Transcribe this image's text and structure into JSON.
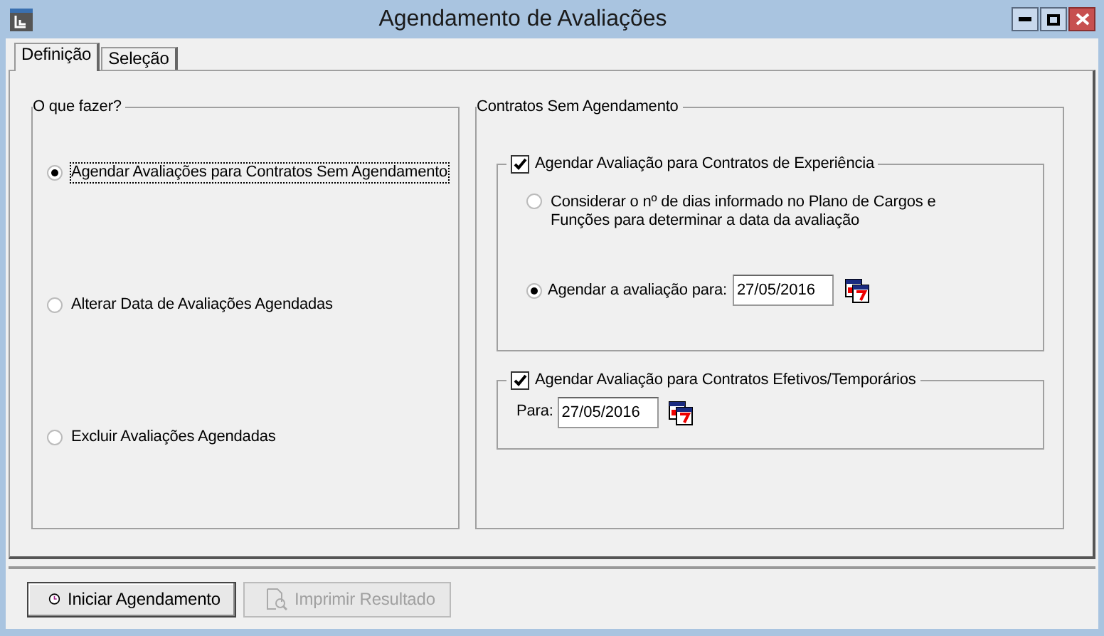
{
  "window": {
    "title": "Agendamento de Avaliações"
  },
  "tabs": [
    {
      "label": "Definição",
      "selected": true
    },
    {
      "label": "Seleção",
      "selected": false
    }
  ],
  "action_group": {
    "title": "O que fazer?",
    "options": [
      {
        "label": "Agendar Avaliações para Contratos Sem Agendamento",
        "selected": true,
        "focused": true
      },
      {
        "label": "Alterar Data de Avaliações Agendadas",
        "selected": false,
        "focused": false
      },
      {
        "label": "Excluir Avaliações Agendadas",
        "selected": false,
        "focused": false
      }
    ]
  },
  "contracts_group": {
    "title": "Contratos Sem Agendamento",
    "experience": {
      "label": "Agendar Avaliação para Contratos de Experiência",
      "checked": true,
      "options": [
        {
          "kind": "text",
          "label": "Considerar o nº de dias informado no Plano de Cargos e Funções para determinar a data da avaliação",
          "selected": false
        },
        {
          "kind": "date",
          "label": "Agendar a avaliação para:",
          "value": "27/05/2016",
          "selected": true
        }
      ]
    },
    "effective": {
      "label": "Agendar Avaliação para Contratos Efetivos/Temporários",
      "checked": true,
      "field_label": "Para:",
      "value": "27/05/2016"
    }
  },
  "buttons": [
    {
      "kind": "clock",
      "label": "Iniciar Agendamento",
      "disabled": false
    },
    {
      "kind": "preview",
      "label": "Imprimir Resultado",
      "disabled": true
    }
  ]
}
